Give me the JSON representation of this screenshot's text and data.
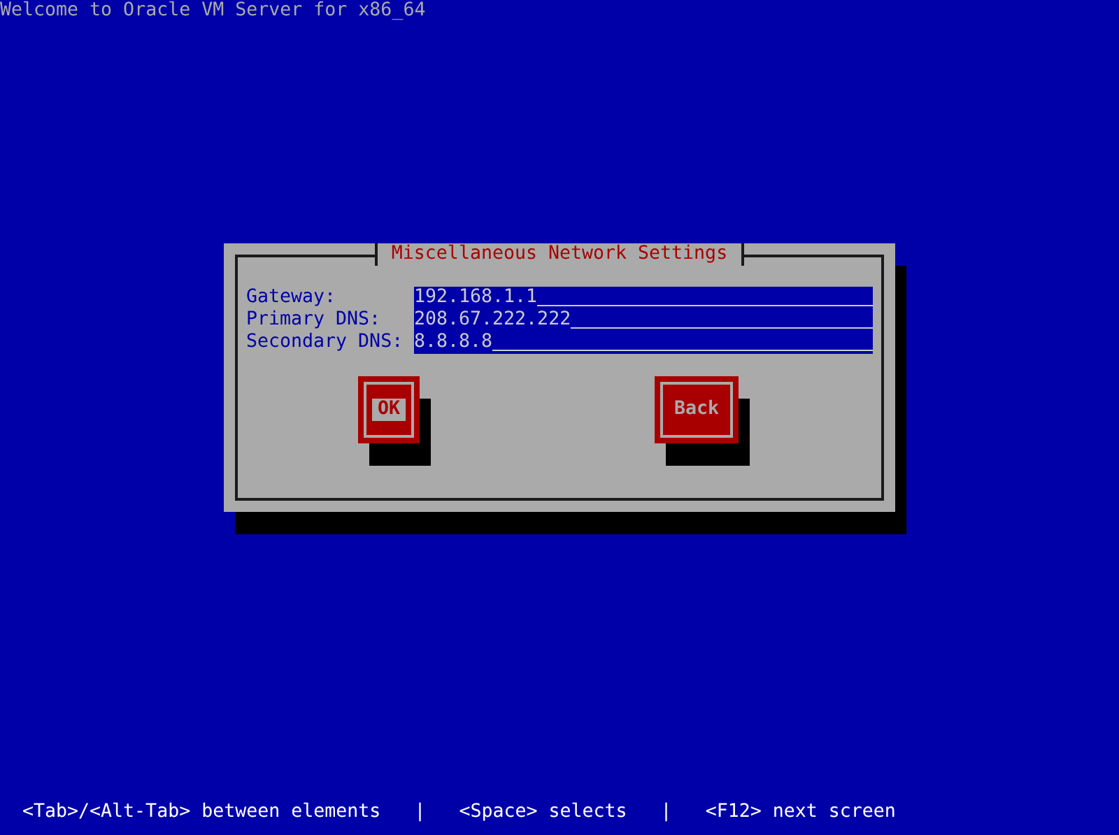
{
  "header": {
    "title": "Welcome to Oracle VM Server for x86_64"
  },
  "dialog": {
    "title": "Miscellaneous Network Settings",
    "fields": [
      {
        "label": "Gateway:",
        "value": "192.168.1.1"
      },
      {
        "label": "Primary DNS:",
        "value": "208.67.222.222"
      },
      {
        "label": "Secondary DNS:",
        "value": "8.8.8.8"
      }
    ],
    "buttons": [
      {
        "label": "OK",
        "selected": true
      },
      {
        "label": "Back",
        "selected": false
      }
    ]
  },
  "status_bar": [
    "<Tab>/<Alt-Tab> between elements",
    "|",
    "<Space> selects",
    "|",
    "<F12> next screen"
  ]
}
